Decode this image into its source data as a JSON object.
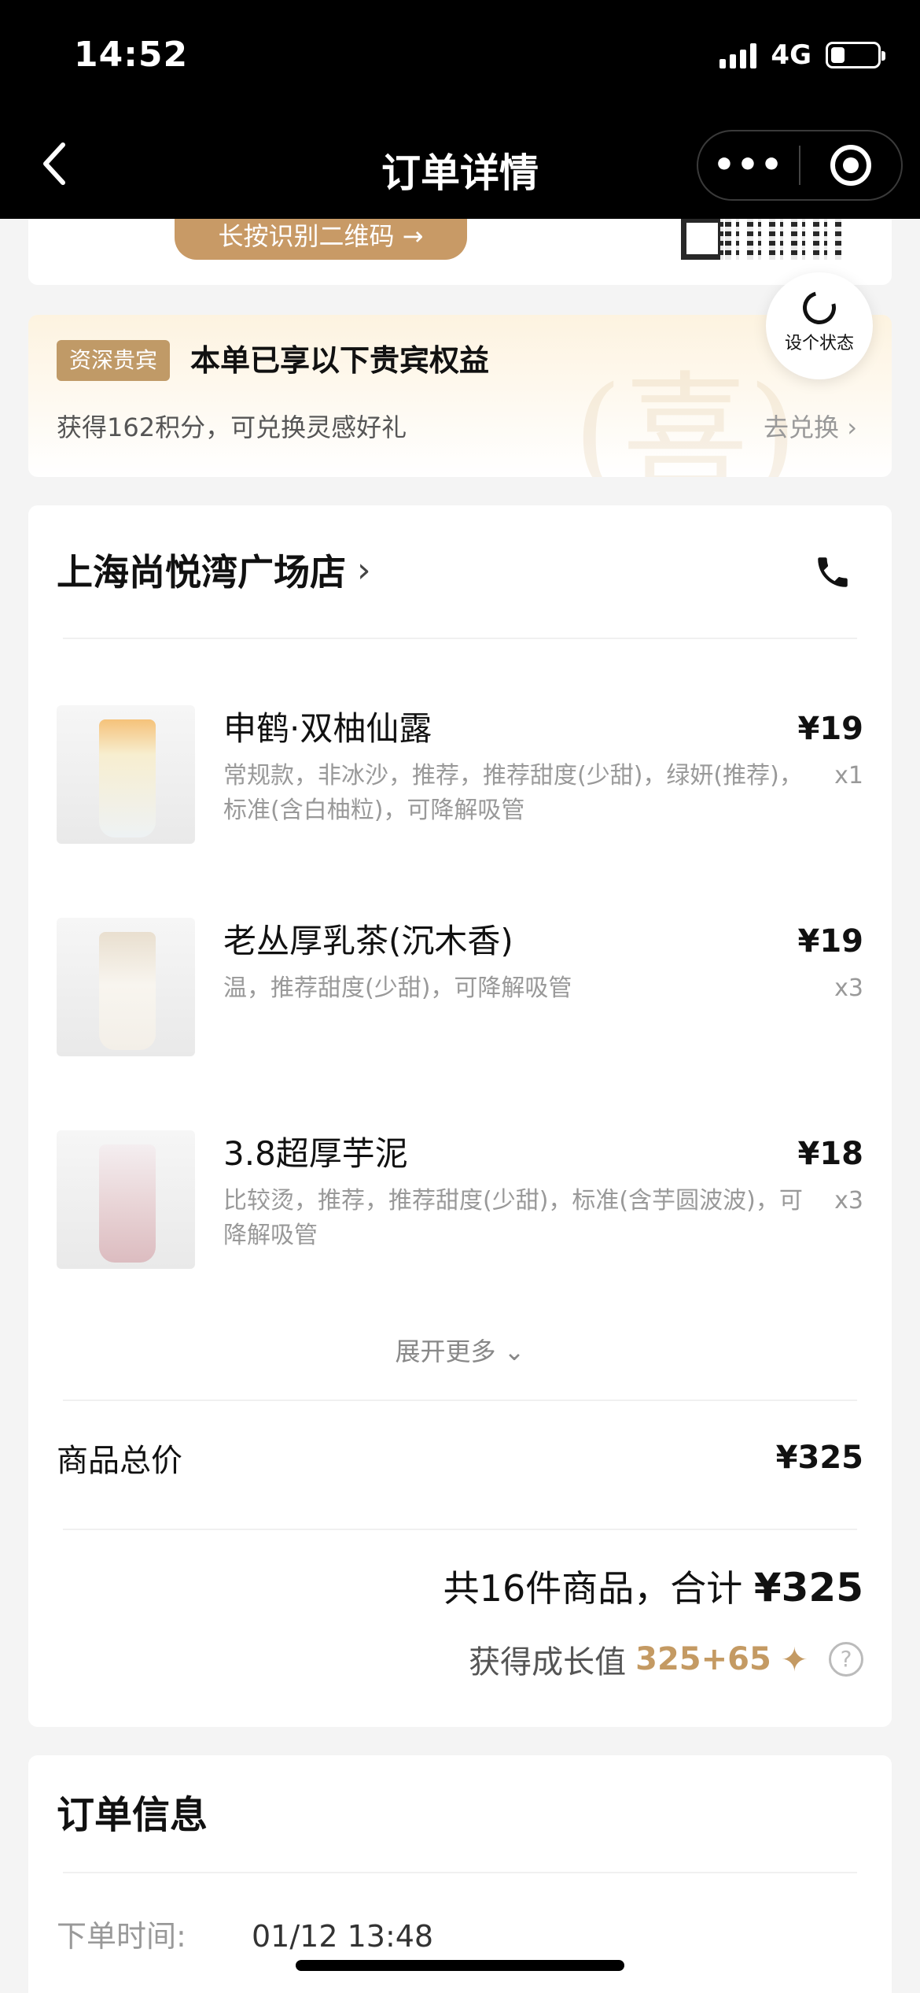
{
  "status_bar": {
    "time": "14:52",
    "network": "4G",
    "battery_level": 0.3
  },
  "nav": {
    "title": "订单详情",
    "more_label": "•••"
  },
  "qr": {
    "hint": "长按识别二维码 →"
  },
  "vip": {
    "badge": "资深贵宾",
    "title": "本单已享以下贵宾权益",
    "points_text": "获得162积分，可兑换灵感好礼",
    "redeem_label": "去兑换 ›",
    "watermark": "(喜)"
  },
  "status_float": {
    "label": "设个状态"
  },
  "store": {
    "name": "上海尚悦湾广场店",
    "arrow": "›"
  },
  "items": [
    {
      "name": "申鹤·双柚仙露",
      "desc": "常规款，非冰沙，推荐，推荐甜度(少甜)，绿妍(推荐)，标准(含白柚粒)，可降解吸管",
      "price": "¥19",
      "qty": "x1",
      "thumb_color": "#f2e6a8"
    },
    {
      "name": "老丛厚乳茶(沉木香)",
      "desc": "温，推荐甜度(少甜)，可降解吸管",
      "price": "¥19",
      "qty": "x3",
      "thumb_color": "#e8dccb"
    },
    {
      "name": "3.8超厚芋泥",
      "desc": "比较烫，推荐，推荐甜度(少甜)，标准(含芋圆波波)，可降解吸管",
      "price": "¥18",
      "qty": "x3",
      "thumb_color": "#e7d3d5"
    }
  ],
  "expand_label": "展开更多 ⌄",
  "subtotal": {
    "label": "商品总价",
    "value": "¥325"
  },
  "summary": {
    "prefix": "共16件商品，合计 ",
    "amount": "¥325"
  },
  "growth": {
    "label": "获得成长值",
    "value": "325+65",
    "star": "✦",
    "help": "?"
  },
  "order_info": {
    "title": "订单信息",
    "order_time_label": "下单时间:",
    "order_time_value": "01/12 13:48"
  },
  "colors": {
    "accent_gold": "#c49a63",
    "badge_gold": "#c09a67"
  }
}
